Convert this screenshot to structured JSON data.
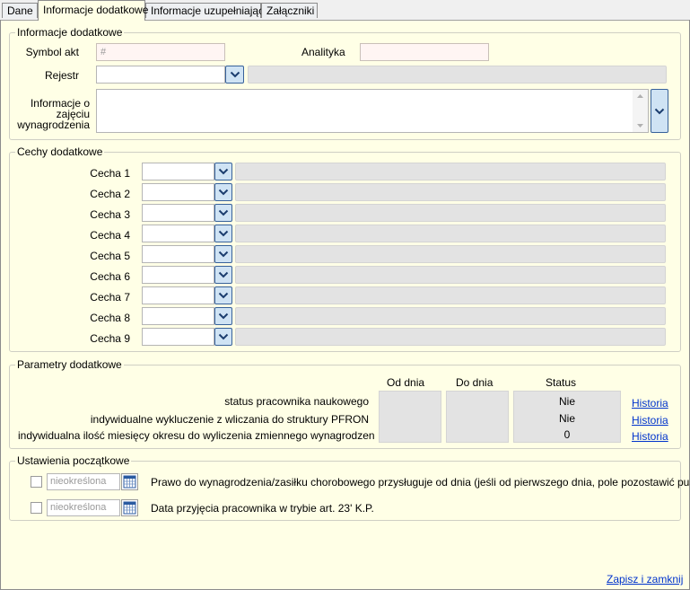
{
  "tabs": [
    "Dane",
    "Informacje dodatkowe",
    "Informacje uzupełniające",
    "Załączniki"
  ],
  "info": {
    "title": "Informacje dodatkowe",
    "symbol_label": "Symbol akt",
    "symbol_placeholder": "#",
    "analityka_label": "Analityka",
    "rejestr_label": "Rejestr",
    "zajecie_label_1": "Informacje o",
    "zajecie_label_2": "zajęciu",
    "zajecie_label_3": "wynagrodzenia"
  },
  "cechy": {
    "title": "Cechy dodatkowe",
    "items": [
      "Cecha 1",
      "Cecha 2",
      "Cecha 3",
      "Cecha 4",
      "Cecha 5",
      "Cecha 6",
      "Cecha 7",
      "Cecha 8",
      "Cecha 9"
    ]
  },
  "params": {
    "title": "Parametry dodatkowe",
    "col_od": "Od dnia",
    "col_do": "Do dnia",
    "col_status": "Status",
    "rows": [
      {
        "label": "status pracownika naukowego",
        "status": "Nie",
        "link": "Historia"
      },
      {
        "label": "indywidualne wykluczenie z wliczania do struktury PFRON",
        "status": "Nie",
        "link": "Historia"
      },
      {
        "label": "indywidualna ilość miesięcy okresu do wyliczenia zmiennego wynagrodzen",
        "status": "0",
        "link": "Historia"
      }
    ]
  },
  "ustawienia": {
    "title": "Ustawienia początkowe",
    "rows": [
      {
        "date": "nieokreślona",
        "label": "Prawo do  wynagrodzenia/zasiłku chorobowego przysługuje od dnia (jeśli od pierwszego dnia, pole pozostawić puste)"
      },
      {
        "date": "nieokreślona",
        "label": "Data przyjęcia pracownika w trybie art. 23' K.P."
      }
    ]
  },
  "footer": {
    "save_link": "Zapisz i zamknij"
  },
  "colors": {
    "background": "#ffffe6",
    "link": "#0033cc",
    "dropdown": "#cfe3f4"
  }
}
